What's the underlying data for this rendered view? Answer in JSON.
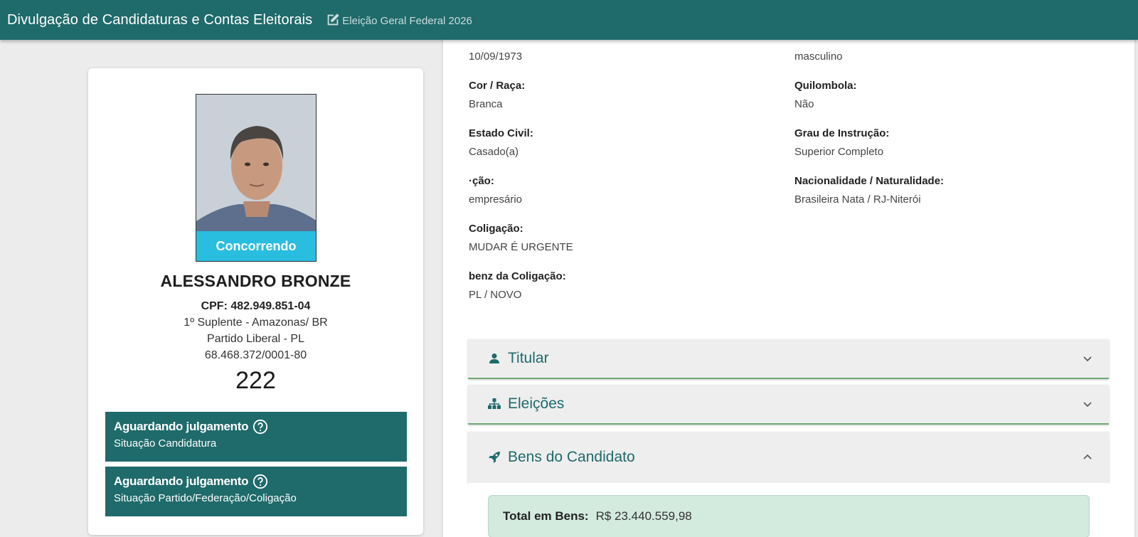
{
  "header": {
    "title": "Divulgação de Candidaturas e Contas Eleitorais",
    "election": "Eleição Geral Federal 2026"
  },
  "candidate": {
    "photo_status": "Concorrendo",
    "name": "ALESSANDRO BRONZE",
    "cpf": "CPF: 482.949.851-04",
    "cargo": "1º Suplente - Amazonas/ BR",
    "partido": "Partido Liberal - PL",
    "cnpj": "68.468.372/0001-80",
    "number": "222",
    "status": [
      {
        "title": "Aguardando julgamento",
        "subtitle": "Situação Candidatura"
      },
      {
        "title": "Aguardando julgamento",
        "subtitle": "Situação Partido/Federação/Coligação"
      }
    ]
  },
  "details": {
    "nascimento": {
      "value": "10/09/1973"
    },
    "genero": {
      "value": "masculino"
    },
    "cor_raca": {
      "label": "Cor / Raça:",
      "value": "Branca"
    },
    "quilombola": {
      "label": "Quilombola:",
      "value": "Não"
    },
    "estado_civil": {
      "label": "Estado Civil:",
      "value": "Casado(a)"
    },
    "grau_instrucao": {
      "label": "Grau de Instrução:",
      "value": "Superior Completo"
    },
    "ocupacao": {
      "label": "·ção:",
      "value": "empresário"
    },
    "nacionalidade": {
      "label": "Nacionalidade / Naturalidade:",
      "value": "Brasileira Nata / RJ-Niterói"
    },
    "coligacao": {
      "label": "Coligação:",
      "value": "MUDAR É URGENTE"
    },
    "partidos_coligacao": {
      "label": "benz da Coligação:",
      "value": "PL / NOVO"
    }
  },
  "accordions": {
    "titular": "Titular",
    "eleicoes": "Eleições",
    "bens": "Bens do Candidato"
  },
  "bens": {
    "total_label": "Total em Bens:",
    "total_value": "R$ 23.440.559,98"
  },
  "icons": {
    "edit": "edit-icon",
    "help": "help-circle-icon",
    "user": "user-icon",
    "sitemap": "sitemap-icon",
    "rocket": "rocket-icon",
    "chevron_down": "chevron-down-icon",
    "chevron_up": "chevron-up-icon"
  },
  "colors": {
    "primary": "#1f6a6b",
    "status_badge": "#29bde0",
    "accordion_border": "#6fa873",
    "total_box": "#d3eadf"
  }
}
